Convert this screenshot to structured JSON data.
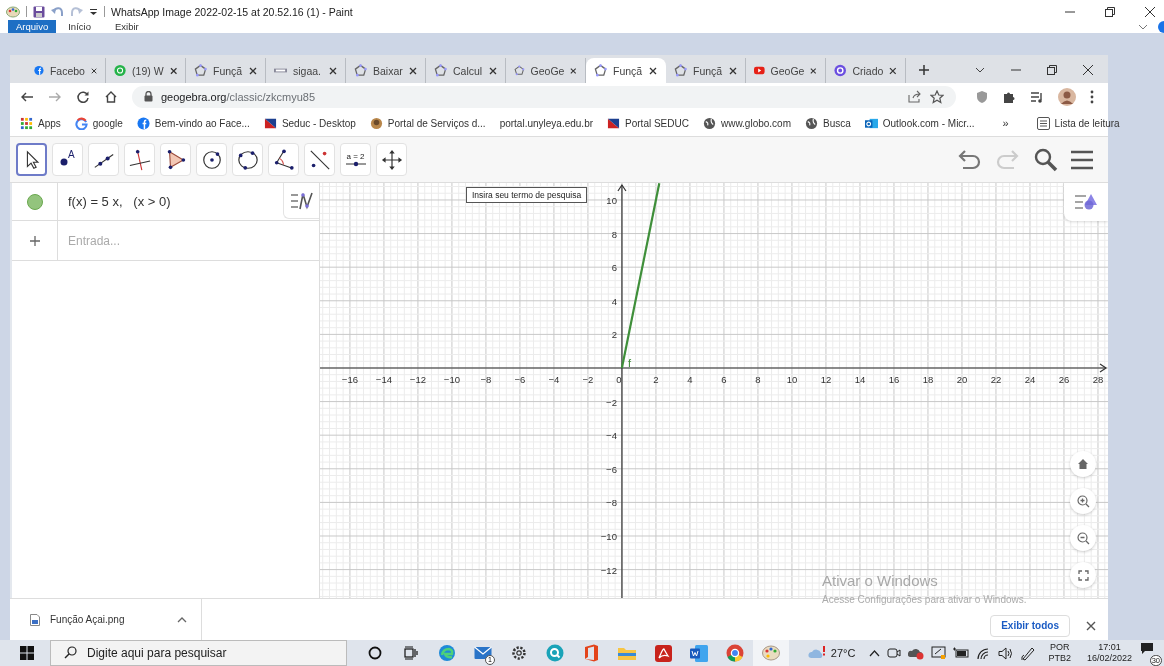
{
  "paint": {
    "title": "WhatsApp Image 2022-02-15 at 20.52.16 (1) - Paint",
    "ribbon_tabs": [
      {
        "label": "Arquivo",
        "selected": true
      },
      {
        "label": "Início",
        "selected": false
      },
      {
        "label": "Exibir",
        "selected": false
      }
    ]
  },
  "browser": {
    "tabs": [
      {
        "label": "Facebo",
        "kind": "facebook",
        "selected": false
      },
      {
        "label": "(19) W",
        "kind": "whatsapp",
        "selected": false
      },
      {
        "label": "Funçã",
        "kind": "geogebra",
        "selected": false
      },
      {
        "label": "sigaa.",
        "kind": "sigaa",
        "selected": false
      },
      {
        "label": "Baixar",
        "kind": "geogebra",
        "selected": false
      },
      {
        "label": "Calcul",
        "kind": "geogebra",
        "selected": false
      },
      {
        "label": "GeoGe",
        "kind": "geogebra",
        "selected": false
      },
      {
        "label": "Funçã",
        "kind": "geogebra",
        "selected": true
      },
      {
        "label": "Funçã",
        "kind": "geogebra",
        "selected": false
      },
      {
        "label": "GeoGe",
        "kind": "youtube",
        "selected": false
      },
      {
        "label": "Criado",
        "kind": "canva",
        "selected": false
      }
    ],
    "address": {
      "host": "geogebra.org",
      "path": "/classic/zkcmyu85"
    },
    "bookmarks": [
      {
        "label": "Apps",
        "kind": "apps"
      },
      {
        "label": "google",
        "kind": "google"
      },
      {
        "label": "Bem-vindo ao Face...",
        "kind": "facebook"
      },
      {
        "label": "Seduc - Desktop",
        "kind": "seduc"
      },
      {
        "label": "Portal de Serviços d...",
        "kind": "portal"
      },
      {
        "label": "portal.unyleya.edu.br",
        "kind": "text"
      },
      {
        "label": "Portal SEDUC",
        "kind": "seduc"
      },
      {
        "label": "www.globo.com",
        "kind": "globe"
      },
      {
        "label": "Busca",
        "kind": "globe"
      },
      {
        "label": "Outlook.com - Micr...",
        "kind": "outlook"
      }
    ],
    "overflow": "»",
    "reading_list": "Lista de leitura"
  },
  "geogebra": {
    "tools": [
      {
        "kind": "move",
        "selected": true
      },
      {
        "kind": "point",
        "label": "A",
        "selected": false
      },
      {
        "kind": "line",
        "selected": false
      },
      {
        "kind": "perpendicular",
        "selected": false
      },
      {
        "kind": "polygon",
        "selected": false
      },
      {
        "kind": "circle-center",
        "selected": false
      },
      {
        "kind": "circle-3pts",
        "selected": false
      },
      {
        "kind": "angle",
        "selected": false
      },
      {
        "kind": "reflect",
        "selected": false
      },
      {
        "kind": "slider",
        "label": "a = 2",
        "selected": false
      },
      {
        "kind": "move-view",
        "selected": false
      }
    ],
    "algebra": {
      "rows": [
        {
          "expression": "f(x) = 5 x,   (x > 0)",
          "visible": true
        }
      ],
      "input_placeholder": "Entrada..."
    },
    "tooltip": "Insira seu termo de pesquisa",
    "graph": {
      "chart_data": {
        "type": "line",
        "grid": true,
        "x": [
          0,
          2.2
        ],
        "series": [
          {
            "name": "f",
            "color": "#3f8f3a",
            "values": [
              0,
              11
            ]
          }
        ],
        "xlim": [
          -17.76,
          28.59
        ],
        "ylim": [
          -13.75,
          11.01
        ],
        "xticks": [
          {
            "value": -16,
            "label": "−16"
          },
          {
            "value": -14,
            "label": "−14"
          },
          {
            "value": -12,
            "label": "−12"
          },
          {
            "value": -10,
            "label": "−10"
          },
          {
            "value": -8,
            "label": "−8"
          },
          {
            "value": -6,
            "label": "−6"
          },
          {
            "value": -4,
            "label": "−4"
          },
          {
            "value": -2,
            "label": "−2"
          },
          0,
          2,
          4,
          6,
          8,
          10,
          12,
          14,
          16,
          18,
          20,
          22,
          24,
          26,
          28
        ],
        "yticks": [
          {
            "value": -12,
            "label": "−12"
          },
          {
            "value": -10,
            "label": "−10"
          },
          {
            "value": -8,
            "label": "−8"
          },
          {
            "value": -6,
            "label": "−6"
          },
          {
            "value": -4,
            "label": "−4"
          },
          {
            "value": -2,
            "label": "−2"
          },
          2,
          4,
          6,
          8,
          10
        ]
      }
    }
  },
  "activation": {
    "title": "Ativar o Windows",
    "text": "Acesse Configurações para ativar o Windows."
  },
  "downloads": {
    "file": "Função Açai.png",
    "show_all": "Exibir todos"
  },
  "taskbar": {
    "search_placeholder": "Digite aqui para pesquisar",
    "apps": [
      {
        "kind": "cortana",
        "active": false
      },
      {
        "kind": "taskview",
        "active": false
      },
      {
        "kind": "edge",
        "active": false
      },
      {
        "kind": "mail",
        "badge": "1",
        "active": false
      },
      {
        "kind": "settings",
        "active": false
      },
      {
        "kind": "qapp",
        "active": false
      },
      {
        "kind": "office",
        "active": false
      },
      {
        "kind": "explorer",
        "active": false
      },
      {
        "kind": "acrobat",
        "active": false
      },
      {
        "kind": "word",
        "active": false
      },
      {
        "kind": "chrome",
        "active": false
      },
      {
        "kind": "paint",
        "active": true
      }
    ],
    "weather": "27°C",
    "language": [
      "POR",
      "PTB2"
    ],
    "time": "17:01",
    "date": "16/02/2022",
    "notifications": "30"
  }
}
